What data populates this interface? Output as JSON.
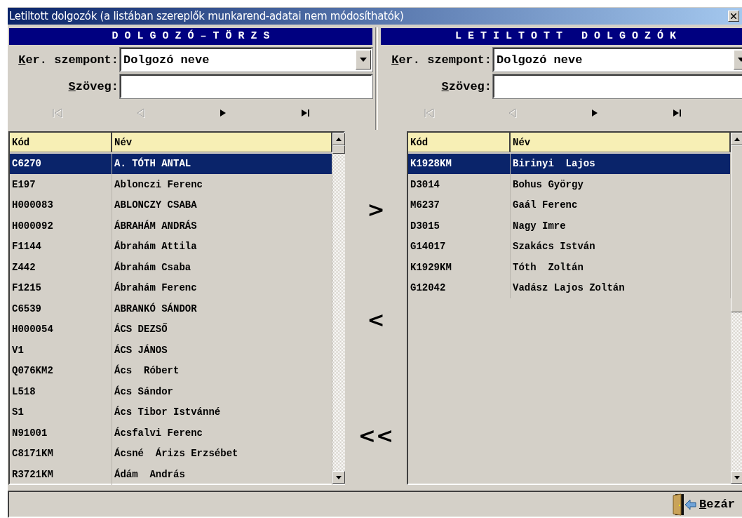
{
  "window": {
    "title": "Letiltott dolgozók (a listában szereplők munkarend-adatai nem módosíthatók)"
  },
  "panels": [
    {
      "header": "D O L G O Z Ó – T Ö R Z S",
      "search_label": "Ker. szempont:",
      "search_value": "Dolgozó neve",
      "text_label": "Szöveg:",
      "nav": [
        {
          "kind": "first",
          "disabled": true
        },
        {
          "kind": "prev",
          "disabled": true
        },
        {
          "kind": "next",
          "disabled": false
        },
        {
          "kind": "last",
          "disabled": false
        }
      ],
      "columns": [
        "Kód",
        "Név"
      ],
      "rows": [
        {
          "code": "C6270",
          "name": "A. TÓTH ANTAL",
          "selected": true
        },
        {
          "code": "E197",
          "name": "Ablonczi Ferenc",
          "selected": false
        },
        {
          "code": "H000083",
          "name": "ABLONCZY CSABA",
          "selected": false
        },
        {
          "code": "H000092",
          "name": "ÁBRAHÁM ANDRÁS",
          "selected": false
        },
        {
          "code": "F1144",
          "name": "Ábrahám Attila",
          "selected": false
        },
        {
          "code": "Z442",
          "name": "Ábrahám Csaba",
          "selected": false
        },
        {
          "code": "F1215",
          "name": "Ábrahám Ferenc",
          "selected": false
        },
        {
          "code": "C6539",
          "name": "ABRANKÓ SÁNDOR",
          "selected": false
        },
        {
          "code": "H000054",
          "name": "ÁCS DEZSŐ",
          "selected": false
        },
        {
          "code": "V1",
          "name": "ÁCS JÁNOS",
          "selected": false
        },
        {
          "code": "Q076KM2",
          "name": "Ács  Róbert",
          "selected": false
        },
        {
          "code": "L518",
          "name": "Ács Sándor",
          "selected": false
        },
        {
          "code": "S1",
          "name": "Ács Tibor Istvánné",
          "selected": false
        },
        {
          "code": "N91001",
          "name": "Ácsfalvi Ferenc",
          "selected": false
        },
        {
          "code": "C8171KM",
          "name": "Ácsné  Árizs Erzsébet",
          "selected": false
        },
        {
          "code": "R3721KM",
          "name": "Ádám  András",
          "selected": false
        }
      ]
    },
    {
      "header": "L E T I L T O T T   D O L G O Z Ó K",
      "search_label": "Ker. szempont:",
      "search_value": "Dolgozó neve",
      "text_label": "Szöveg:",
      "nav": [
        {
          "kind": "first",
          "disabled": true
        },
        {
          "kind": "prev",
          "disabled": true
        },
        {
          "kind": "next",
          "disabled": false
        },
        {
          "kind": "last",
          "disabled": false
        }
      ],
      "columns": [
        "Kód",
        "Név"
      ],
      "rows": [
        {
          "code": "K1928KM",
          "name": "Birinyi  Lajos",
          "selected": true
        },
        {
          "code": "D3014",
          "name": "Bohus György",
          "selected": false
        },
        {
          "code": "M6237",
          "name": "Gaál Ferenc",
          "selected": false
        },
        {
          "code": "D3015",
          "name": "Nagy Imre",
          "selected": false
        },
        {
          "code": "G14017",
          "name": "Szakács István",
          "selected": false
        },
        {
          "code": "K1929KM",
          "name": "Tóth  Zoltán",
          "selected": false
        },
        {
          "code": "G12042",
          "name": "Vadász Lajos Zoltán",
          "selected": false
        }
      ]
    }
  ],
  "transfer_buttons": [
    ">",
    "<",
    "<<"
  ],
  "close_button": "Bezár"
}
